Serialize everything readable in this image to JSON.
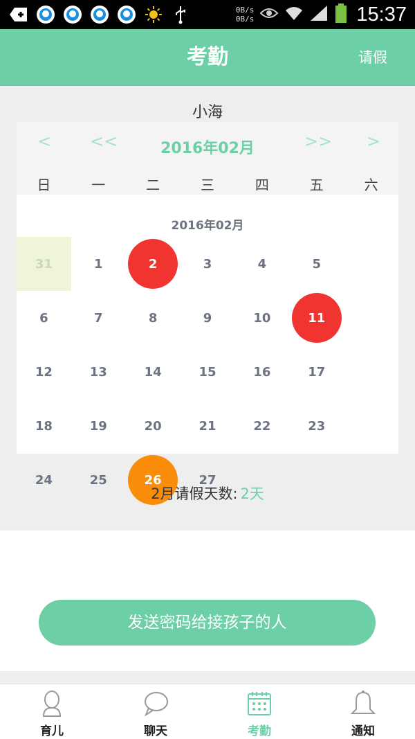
{
  "status_bar": {
    "net_up": "0B/s",
    "net_down": "0B/s",
    "time": "15:37",
    "icons": [
      "add-icon",
      "qq-icon",
      "qq-icon",
      "qq-icon",
      "qq-icon",
      "sun-icon",
      "usb-icon",
      "eye-icon",
      "wifi-icon",
      "signal-icon",
      "battery-icon"
    ]
  },
  "header": {
    "title": "考勤",
    "action": "请假"
  },
  "child_name": "小海",
  "calendar": {
    "nav_prev": "<",
    "nav_prev_year": "<<",
    "month_title": "2016年02月",
    "nav_next_year": ">>",
    "nav_next": ">",
    "weekdays": [
      "日",
      "一",
      "二",
      "三",
      "四",
      "五",
      "六"
    ],
    "grid_month_label": "2016年02月",
    "days": [
      "31",
      "1",
      "2",
      "3",
      "4",
      "5",
      "6",
      "7",
      "8",
      "9",
      "10",
      "11",
      "12",
      "13",
      "14",
      "15",
      "16",
      "17",
      "18",
      "19",
      "20",
      "21",
      "22",
      "23",
      "24",
      "25",
      "26",
      "27"
    ],
    "marked_red": [
      "2",
      "11"
    ],
    "marked_orange": [
      "26"
    ],
    "colors": {
      "red": "#f03530",
      "orange": "#f98c09",
      "accent": "#6ccfa6"
    }
  },
  "summary": {
    "label": "2月请假天数:",
    "value": "2天"
  },
  "send_button": "发送密码给接孩子的人",
  "bottom_nav": [
    {
      "label": "育儿",
      "icon": "person-icon",
      "active": false
    },
    {
      "label": "聊天",
      "icon": "chat-bubble-icon",
      "active": false
    },
    {
      "label": "考勤",
      "icon": "calendar-icon",
      "active": true
    },
    {
      "label": "通知",
      "icon": "bell-icon",
      "active": false
    }
  ]
}
